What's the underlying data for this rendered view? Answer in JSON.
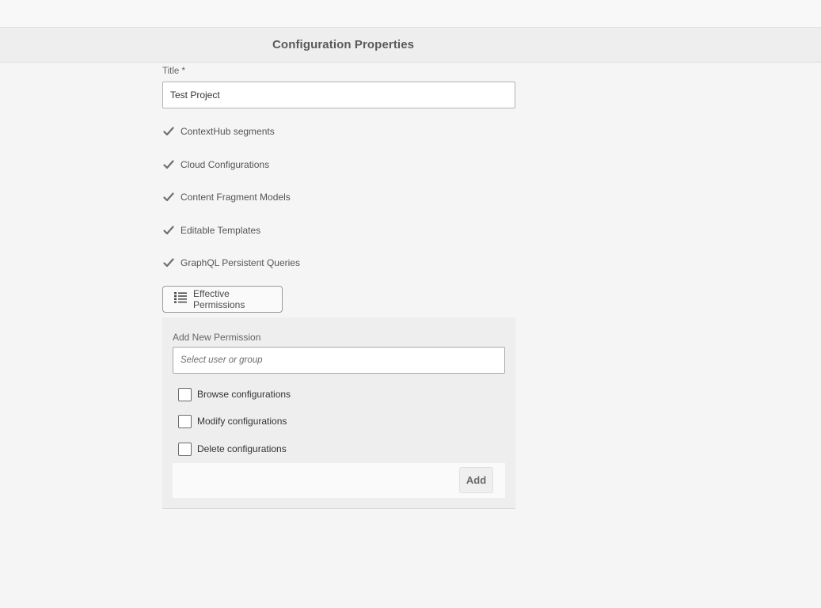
{
  "page": {
    "title": "Configuration Properties"
  },
  "form": {
    "title_label": "Title *",
    "title_value": "Test Project",
    "features": [
      {
        "label": "ContextHub segments",
        "checked": true
      },
      {
        "label": "Cloud Configurations",
        "checked": true
      },
      {
        "label": "Content Fragment Models",
        "checked": true
      },
      {
        "label": "Editable Templates",
        "checked": true
      },
      {
        "label": "GraphQL Persistent Queries",
        "checked": true
      }
    ],
    "effective_permissions_label": "Effective Permissions",
    "effective_permissions_icon": "list-icon"
  },
  "permission": {
    "label": "Add New Permission",
    "user_placeholder": "Select user or group",
    "user_value": "",
    "options": [
      {
        "label": "Browse configurations",
        "checked": false
      },
      {
        "label": "Modify configurations",
        "checked": false
      },
      {
        "label": "Delete configurations",
        "checked": false
      }
    ],
    "add_label": "Add"
  },
  "colors": {
    "background": "#f5f5f5",
    "titlebar": "#eeeeee",
    "checkmark": "#6e6e6e"
  }
}
